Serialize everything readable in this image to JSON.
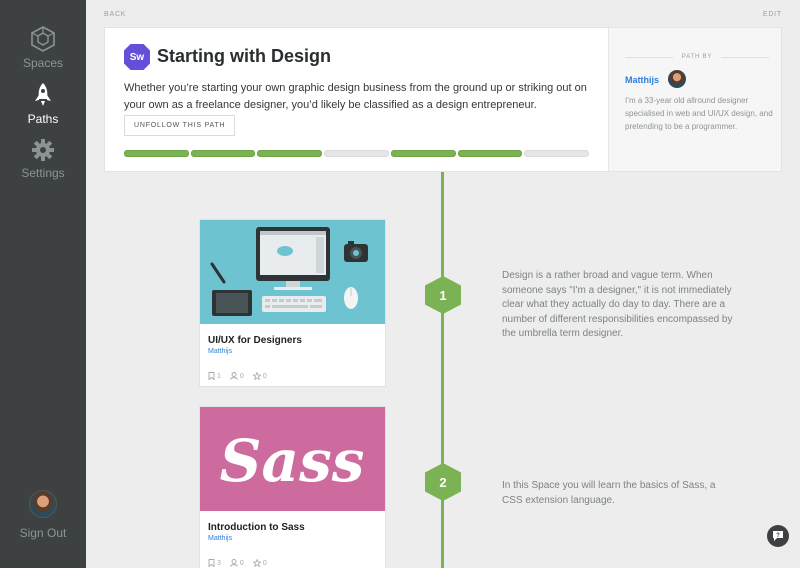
{
  "sidebar": {
    "items": [
      {
        "label": "Spaces",
        "icon": "cube-icon",
        "active": false
      },
      {
        "label": "Paths",
        "icon": "rocket-icon",
        "active": true
      },
      {
        "label": "Settings",
        "icon": "gear-icon",
        "active": false
      }
    ],
    "signout_label": "Sign Out"
  },
  "topbar": {
    "back_label": "BACK",
    "edit_label": "EDIT"
  },
  "path": {
    "badge": "Sw",
    "title": "Starting with Design",
    "description": "Whether you’re starting your own graphic design business from the ground up or striking out on your own as a freelance designer, you’d likely be classified as a design entrepreneur.",
    "unfollow_label": "UNFOLLOW THIS PATH",
    "progress": [
      true,
      true,
      true,
      false,
      true,
      true,
      false
    ]
  },
  "author": {
    "section_label": "PATH BY",
    "name": "Matthijs",
    "bio": "I’m a 33-year old allround designer specialised in web and UI/UX design, and pretending to be a programmer."
  },
  "steps": [
    {
      "number": "1",
      "title": "UI/UX for Designers",
      "author": "Matthijs",
      "bookmarks": "1",
      "followers": "0",
      "stars": "0",
      "text": "Design is a rather broad and vague term. When someone says \"I'm a designer,\" it is not immediately clear what they actually do day to day. There are a number of different responsibilities encompassed by the umbrella term designer."
    },
    {
      "number": "2",
      "title": "Introduction to Sass",
      "author": "Matthijs",
      "bookmarks": "3",
      "followers": "0",
      "stars": "0",
      "thumb_text": "Sass",
      "text": "In this Space you will learn the basics of Sass, a CSS extension language."
    }
  ],
  "colors": {
    "sidebar": "#3d4142",
    "accent_green": "#7bb254",
    "badge_purple": "#6450d8",
    "link_blue": "#2e7fd8",
    "thumb_cyan": "#6ec3d0",
    "thumb_pink": "#cd6a9e"
  }
}
